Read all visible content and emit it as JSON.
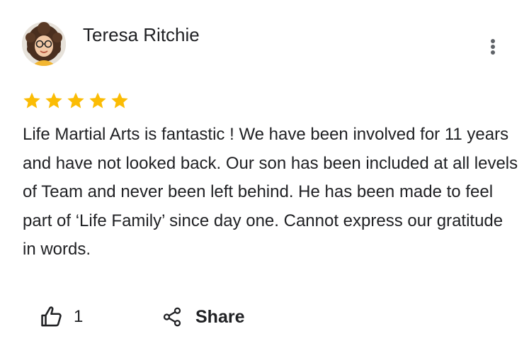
{
  "reviewer": {
    "name": "Teresa Ritchie"
  },
  "rating": {
    "stars": 5,
    "max": 5,
    "star_color": "#fbbc04"
  },
  "review": {
    "text": "Life Martial Arts is fantastic ! We have been involved for 11 years and have not looked back. Our son has been included at all levels of Team and never been left behind. He has been made to feel part of ‘Life Family’ since day one. Cannot express our gratitude in words."
  },
  "actions": {
    "like_count": "1",
    "share_label": "Share"
  },
  "icons": {
    "more": "more-vert-icon",
    "like": "thumb-up-icon",
    "share": "share-icon"
  }
}
